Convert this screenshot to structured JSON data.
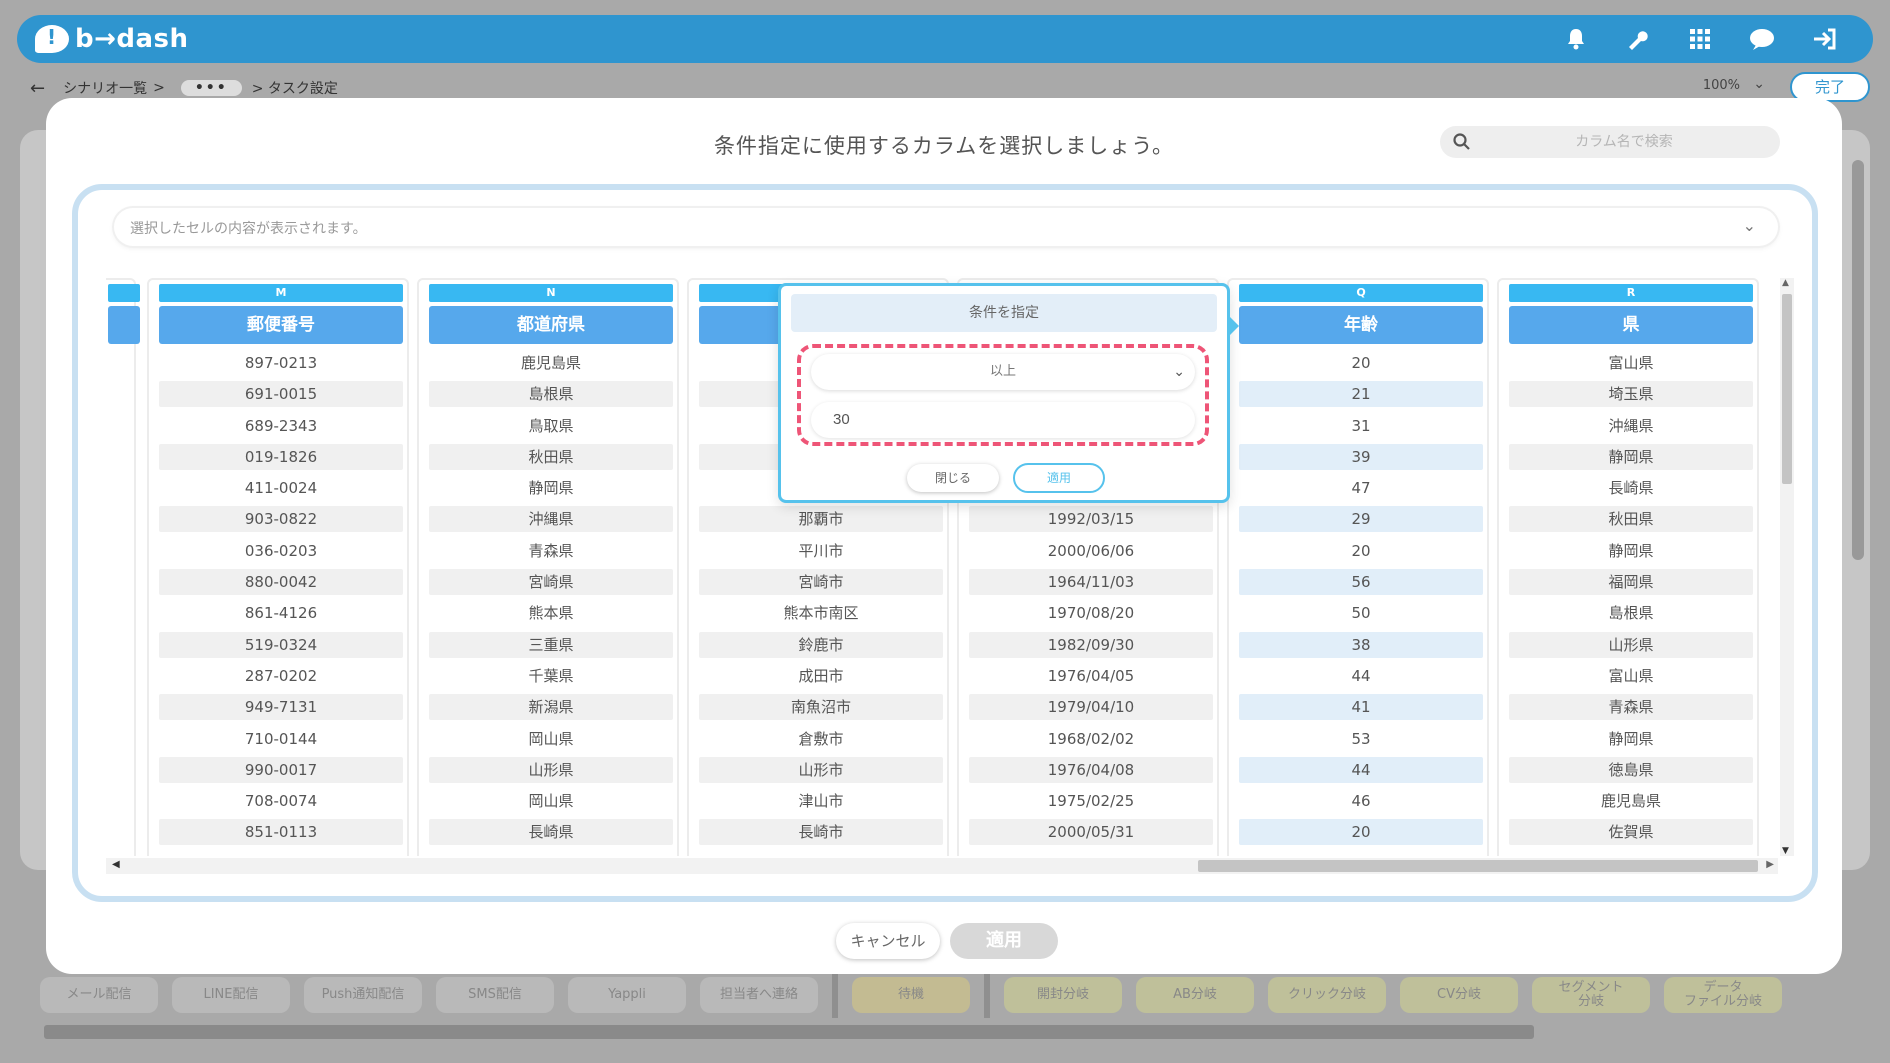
{
  "app": {
    "logo_text": "b→dash",
    "breadcrumb": {
      "first": "シナリオ一覧",
      "sep": ">",
      "dots": "•••",
      "current": "> タスク設定"
    },
    "zoom": "100%",
    "done_label": "完了"
  },
  "palette": [
    {
      "label": "メール配信",
      "tone": "plain"
    },
    {
      "label": "LINE配信",
      "tone": "plain"
    },
    {
      "label": "Push通知配信",
      "tone": "plain"
    },
    {
      "label": "SMS配信",
      "tone": "plain"
    },
    {
      "label": "Yappli",
      "tone": "plain"
    },
    {
      "label": "担当者へ連絡",
      "tone": "plain"
    },
    {
      "label": "待機",
      "tone": "yellow"
    },
    {
      "label": "開封分岐",
      "tone": "green"
    },
    {
      "label": "AB分岐",
      "tone": "green"
    },
    {
      "label": "クリック分岐",
      "tone": "green"
    },
    {
      "label": "CV分岐",
      "tone": "green"
    },
    {
      "label": "セグメント\n分岐",
      "tone": "green"
    },
    {
      "label": "データ\nファイル分岐",
      "tone": "green"
    }
  ],
  "modal": {
    "title": "条件指定に使用するカラムを選択しましょう。",
    "search_placeholder": "カラム名で検索",
    "cell_bar_text": "選択したセルの内容が表示されます。",
    "columns": [
      {
        "letter": "M",
        "name": "郵便番号",
        "rows": [
          "897-0213",
          "691-0015",
          "689-2343",
          "019-1826",
          "411-0024",
          "903-0822",
          "036-0203",
          "880-0042",
          "861-4126",
          "519-0324",
          "287-0202",
          "949-7131",
          "710-0144",
          "990-0017",
          "708-0074",
          "851-0113"
        ]
      },
      {
        "letter": "N",
        "name": "都道府県",
        "rows": [
          "鹿児島県",
          "島根県",
          "鳥取県",
          "秋田県",
          "静岡県",
          "沖縄県",
          "青森県",
          "宮崎県",
          "熊本県",
          "三重県",
          "千葉県",
          "新潟県",
          "岡山県",
          "山形県",
          "岡山県",
          "長崎県"
        ]
      },
      {
        "letter": "",
        "name": "",
        "rows": [
          "",
          "",
          "",
          "",
          "",
          "那覇市",
          "平川市",
          "宮崎市",
          "熊本市南区",
          "鈴鹿市",
          "成田市",
          "南魚沼市",
          "倉敷市",
          "山形市",
          "津山市",
          "長崎市"
        ]
      },
      {
        "letter": "",
        "name": "",
        "rows": [
          "",
          "",
          "",
          "",
          "",
          "1992/03/15",
          "2000/06/06",
          "1964/11/03",
          "1970/08/20",
          "1982/09/30",
          "1976/04/05",
          "1979/04/10",
          "1968/02/02",
          "1976/04/08",
          "1975/02/25",
          "2000/05/31"
        ]
      },
      {
        "letter": "Q",
        "name": "年齢",
        "rows": [
          "20",
          "21",
          "31",
          "39",
          "47",
          "29",
          "20",
          "56",
          "50",
          "38",
          "44",
          "41",
          "53",
          "44",
          "46",
          "20"
        ]
      },
      {
        "letter": "R",
        "name": "県",
        "rows": [
          "富山県",
          "埼玉県",
          "沖縄県",
          "静岡県",
          "長崎県",
          "秋田県",
          "静岡県",
          "福岡県",
          "島根県",
          "山形県",
          "富山県",
          "青森県",
          "静岡県",
          "徳島県",
          "鹿児島県",
          "佐賀県"
        ]
      }
    ],
    "popup": {
      "title": "条件を指定",
      "operator": "以上",
      "value": "30",
      "close_label": "閉じる",
      "apply_label": "適用"
    },
    "cancel_label": "キャンセル",
    "apply_label": "適用"
  },
  "colors": {
    "brand_blue": "#2f95cf",
    "column_letter": "#38b8f2",
    "column_header": "#56a8ec",
    "popup_border": "#56c2ec",
    "dash_highlight": "#ee5577"
  }
}
